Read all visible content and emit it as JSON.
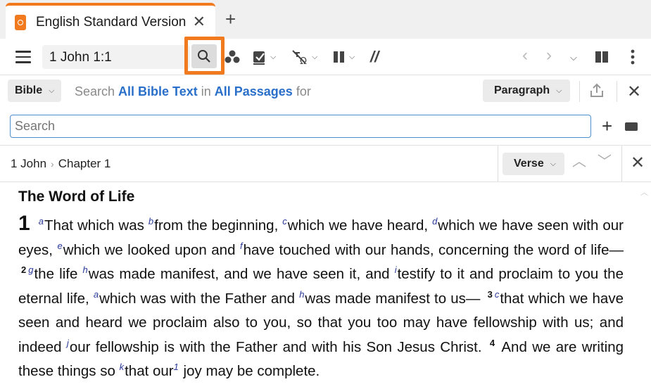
{
  "tab": {
    "title": "English Standard Version"
  },
  "toolbar": {
    "reference": "1 John 1:1"
  },
  "search": {
    "scope_button": "Bible",
    "desc_prefix": "Search ",
    "desc_text_link": "All Bible Text",
    "desc_in": " in ",
    "desc_passages_link": "All Passages",
    "desc_for": " for",
    "view_button": "Paragraph",
    "placeholder": "Search"
  },
  "breadcrumb": {
    "book": "1 John",
    "chapter": "Chapter 1",
    "verse_button": "Verse"
  },
  "passage": {
    "heading": "The Word of Life",
    "chapter_number": "1",
    "segments": [
      {
        "t": "fn",
        "v": "a"
      },
      {
        "t": "txt",
        "v": "That which was "
      },
      {
        "t": "fn",
        "v": "b"
      },
      {
        "t": "txt",
        "v": "from the beginning, "
      },
      {
        "t": "fn",
        "v": "c"
      },
      {
        "t": "txt",
        "v": "which we have heard, "
      },
      {
        "t": "fn",
        "v": "d"
      },
      {
        "t": "txt",
        "v": "which we have seen with our eyes, "
      },
      {
        "t": "fn",
        "v": "e"
      },
      {
        "t": "txt",
        "v": "which we looked upon and "
      },
      {
        "t": "fn",
        "v": "f"
      },
      {
        "t": "txt",
        "v": "have touched with our hands, concerning the word of life— "
      },
      {
        "t": "vn",
        "v": "2"
      },
      {
        "t": "fn",
        "v": "g"
      },
      {
        "t": "txt",
        "v": "the life "
      },
      {
        "t": "fn",
        "v": "h"
      },
      {
        "t": "txt",
        "v": "was made manifest, and we have seen it, and "
      },
      {
        "t": "fn",
        "v": "i"
      },
      {
        "t": "txt",
        "v": "testify to it and proclaim to you the eternal life, "
      },
      {
        "t": "fn",
        "v": "a"
      },
      {
        "t": "txt",
        "v": "which was with the Father and "
      },
      {
        "t": "fn",
        "v": "h"
      },
      {
        "t": "txt",
        "v": "was made manifest to us— "
      },
      {
        "t": "vn",
        "v": "3"
      },
      {
        "t": "fn",
        "v": "c"
      },
      {
        "t": "txt",
        "v": "that which we have seen and heard we proclaim also to you, so that you too may have fellowship with us; and indeed "
      },
      {
        "t": "fn",
        "v": "j"
      },
      {
        "t": "txt",
        "v": "our fellowship is with the Father and with his Son Jesus Christ. "
      },
      {
        "t": "vn",
        "v": "4"
      },
      {
        "t": "txt",
        "v": " And we are writing these things so "
      },
      {
        "t": "fn",
        "v": "k"
      },
      {
        "t": "txt",
        "v": "that our"
      },
      {
        "t": "fn",
        "v": "1"
      },
      {
        "t": "txt",
        "v": " joy may be complete."
      }
    ]
  },
  "colors": {
    "accent": "#f07a1d",
    "link": "#2a6fc9",
    "footnote": "#2a3a9a",
    "focus_border": "#4a8fd0"
  },
  "icons": {
    "app": "esv-book-icon",
    "close": "close-icon",
    "new_tab": "plus-icon",
    "menu": "hamburger-icon",
    "search": "search-icon",
    "visual_filter": "dots-cluster-icon",
    "checklist": "checkbox-icon",
    "interlinear": "interlinear-icon",
    "parallel": "columns-icon",
    "separator": "double-slash-icon",
    "back": "chevron-left-icon",
    "forward": "chevron-right-icon",
    "dropdown": "chevron-down-icon",
    "layout": "split-view-icon",
    "more": "vertical-dots-icon",
    "share": "share-icon",
    "add": "plus-icon",
    "keyboard": "keyboard-icon",
    "prev": "chevron-up-icon",
    "next": "chevron-down-icon"
  }
}
